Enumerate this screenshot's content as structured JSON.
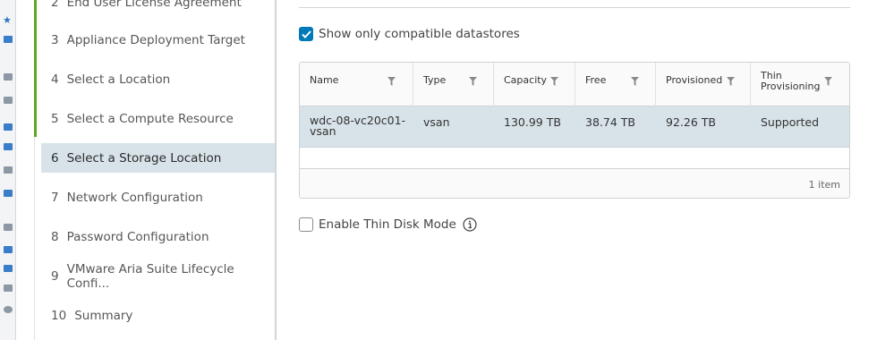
{
  "wizard": {
    "steps": [
      {
        "num": "2",
        "label": "End User License Agreement"
      },
      {
        "num": "3",
        "label": "Appliance Deployment Target"
      },
      {
        "num": "4",
        "label": "Select a Location"
      },
      {
        "num": "5",
        "label": "Select a Compute Resource"
      },
      {
        "num": "6",
        "label": "Select a Storage Location"
      },
      {
        "num": "7",
        "label": "Network Configuration"
      },
      {
        "num": "8",
        "label": "Password Configuration"
      },
      {
        "num": "9",
        "label": "VMware Aria Suite Lifecycle Confi..."
      },
      {
        "num": "10",
        "label": "Summary"
      }
    ],
    "active_step": "6"
  },
  "storage": {
    "compatible_label": "Show only compatible datastores",
    "compatible_checked": true,
    "columns": [
      "Name",
      "Type",
      "Capacity",
      "Free",
      "Provisioned",
      "Thin Provisioning"
    ],
    "thin_col_line1": "Thin",
    "thin_col_line2": "Provisioning",
    "rows": [
      {
        "name_line1": "wdc-08-vc20c01-",
        "name_line2": "vsan",
        "type": "vsan",
        "capacity": "130.99 TB",
        "free": "38.74 TB",
        "provisioned": "92.26 TB",
        "thin": "Supported"
      }
    ],
    "footer_count": "1 item",
    "thin_disk_label": "Enable Thin Disk Mode",
    "thin_disk_checked": false
  },
  "colors": {
    "accent": "#0079b8",
    "progress_green": "#62a420",
    "selected_bg": "#d8e3e9"
  }
}
